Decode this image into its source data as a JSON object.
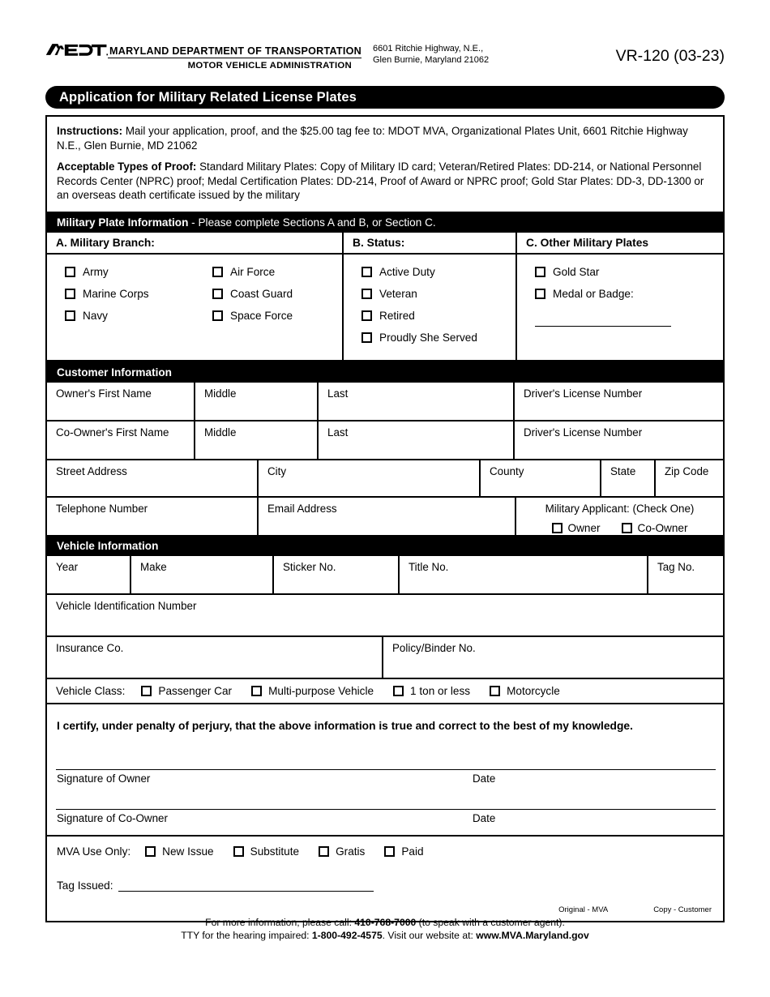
{
  "header": {
    "logo_alt": "MDOT",
    "agency_line1": "MARYLAND DEPARTMENT OF TRANSPORTATION",
    "agency_line2": "MOTOR VEHICLE ADMINISTRATION",
    "address_line1": "6601 Ritchie Highway, N.E.,",
    "address_line2": "Glen Burnie, Maryland 21062",
    "form_number": "VR-120 (03-23)"
  },
  "title": "Application for Military Related License Plates",
  "instructions": {
    "label_1": "Instructions:",
    "text_1": " Mail your application, proof, and the $25.00 tag fee to: MDOT MVA, Organizational Plates Unit, 6601 Ritchie Highway N.E., Glen Burnie, MD 21062",
    "label_2": "Acceptable Types of Proof:",
    "text_2": " Standard Military Plates: Copy of Military ID card; Veteran/Retired Plates: DD-214, or National Personnel Records Center (NPRC) proof; Medal Certification Plates: DD-214, Proof of Award or NPRC proof; Gold Star Plates: DD-3, DD-1300 or an overseas death certificate issued by the military"
  },
  "military_plate": {
    "header_bold": "Military Plate Information",
    "header_rest": " - Please complete Sections A and B, or Section C.",
    "section_a_title": "A. Military Branch:",
    "section_b_title": "B. Status:",
    "section_c_title": "C. Other Military Plates",
    "branches_col1": [
      "Army",
      "Marine Corps",
      "Navy"
    ],
    "branches_col2": [
      "Air Force",
      "Coast Guard",
      "Space Force"
    ],
    "statuses": [
      "Active Duty",
      "Veteran",
      "Retired",
      "Proudly She Served"
    ],
    "other_plates": [
      "Gold Star",
      "Medal or Badge:"
    ]
  },
  "customer_information": {
    "header": "Customer Information",
    "owner_row": [
      "Owner's First Name",
      "Middle",
      "Last",
      "Driver's License Number"
    ],
    "coowner_row": [
      "Co-Owner's First Name",
      "Middle",
      "Last",
      "Driver's License Number"
    ],
    "address_row": [
      "Street Address",
      "City",
      "County",
      "State",
      "Zip Code"
    ],
    "contact_row": [
      "Telephone Number",
      "Email Address"
    ],
    "military_applicant_title": "Military Applicant: (Check One)",
    "military_applicant_options": [
      "Owner",
      "Co-Owner"
    ]
  },
  "vehicle_information": {
    "header": "Vehicle Information",
    "row1": [
      "Year",
      "Make",
      "Sticker No.",
      "Title No.",
      "Tag No."
    ],
    "vin_label": "Vehicle Identification Number",
    "insurance_label": "Insurance Co.",
    "policy_label": "Policy/Binder No.",
    "vehicle_class_label": "Vehicle Class:",
    "vehicle_classes": [
      "Passenger Car",
      "Multi-purpose Vehicle",
      "1 ton or less",
      "Motorcycle"
    ]
  },
  "certification": {
    "statement": "I certify, under penalty of perjury, that the above information is true and correct to the best of my knowledge.",
    "owner_signature_label": "Signature of Owner",
    "owner_date_label": "Date",
    "coowner_signature_label": "Signature of Co-Owner",
    "coowner_date_label": "Date"
  },
  "mva_use_only": {
    "label": "MVA Use Only:",
    "options": [
      "New Issue",
      "Substitute",
      "Gratis",
      "Paid"
    ],
    "tag_issued_label": "Tag Issued:",
    "copy_original": "Original - MVA",
    "copy_customer": "Copy - Customer"
  },
  "footer": {
    "line1_pre": "For more information, please call: ",
    "line1_phone": "410-768-7000",
    "line1_post": " (to speak with a customer agent).",
    "line2_pre": "TTY for the hearing impaired: ",
    "line2_tty": "1-800-492-4575",
    "line2_mid": ". Visit our website at: ",
    "line2_site": "www.MVA.Maryland.gov"
  }
}
